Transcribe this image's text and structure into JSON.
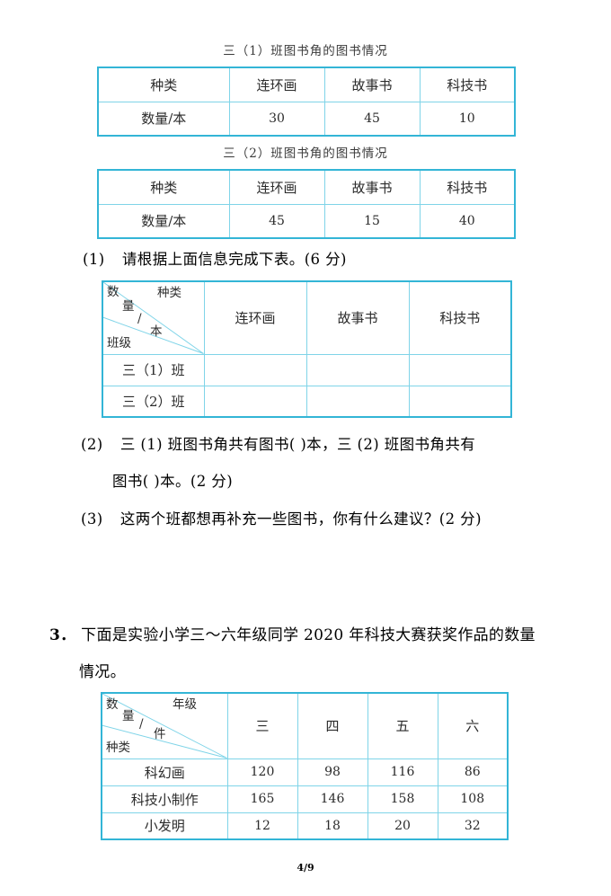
{
  "page": {
    "footer": "4/9"
  },
  "table1": {
    "caption": "三（1）班图书角的图书情况",
    "rows": [
      [
        "种类",
        "连环画",
        "故事书",
        "科技书"
      ],
      [
        "数量/本",
        "30",
        "45",
        "10"
      ]
    ]
  },
  "table2": {
    "caption": "三（2）班图书角的图书情况",
    "rows": [
      [
        "种类",
        "连环画",
        "故事书",
        "科技书"
      ],
      [
        "数量/本",
        "45",
        "15",
        "40"
      ]
    ]
  },
  "question1": {
    "label": "(1)",
    "text": "请根据上面信息完成下表。(6 分)",
    "table": {
      "corner": {
        "top_right": "种类",
        "middle_1": "数",
        "middle_2": "量",
        "middle_3": "/",
        "middle_4": "本",
        "bottom_left": "班级"
      },
      "columns": [
        "连环画",
        "故事书",
        "科技书"
      ],
      "rows": [
        {
          "label": "三（1）班",
          "values": [
            "",
            "",
            ""
          ]
        },
        {
          "label": "三（2）班",
          "values": [
            "",
            "",
            ""
          ]
        }
      ]
    }
  },
  "question2": {
    "label": "(2)",
    "line1": "三 (1) 班图书角共有图书(          )本，三 (2) 班图书角共有",
    "line2": "图书(          )本。(2 分)"
  },
  "question3": {
    "label": "(3)",
    "text": "这两个班都想再补充一些图书，你有什么建议？(2 分)"
  },
  "problem3": {
    "label": "3．",
    "line1": "下面是实验小学三～六年级同学 2020 年科技大赛获奖作品的数量",
    "line2": "情况。",
    "table": {
      "corner": {
        "top_right": "年级",
        "middle_1": "数",
        "middle_2": "量",
        "middle_3": "/",
        "middle_4": "件",
        "bottom_left": "种类"
      },
      "columns": [
        "三",
        "四",
        "五",
        "六"
      ],
      "rows": [
        {
          "label": "科幻画",
          "values": [
            "120",
            "98",
            "116",
            "86"
          ]
        },
        {
          "label": "科技小制作",
          "values": [
            "165",
            "146",
            "158",
            "108"
          ]
        },
        {
          "label": "小发明",
          "values": [
            "12",
            "18",
            "20",
            "32"
          ]
        }
      ]
    }
  },
  "colors": {
    "border_outer": "#33b5d6",
    "border_inner": "#7fd4e8",
    "text": "#000000"
  }
}
